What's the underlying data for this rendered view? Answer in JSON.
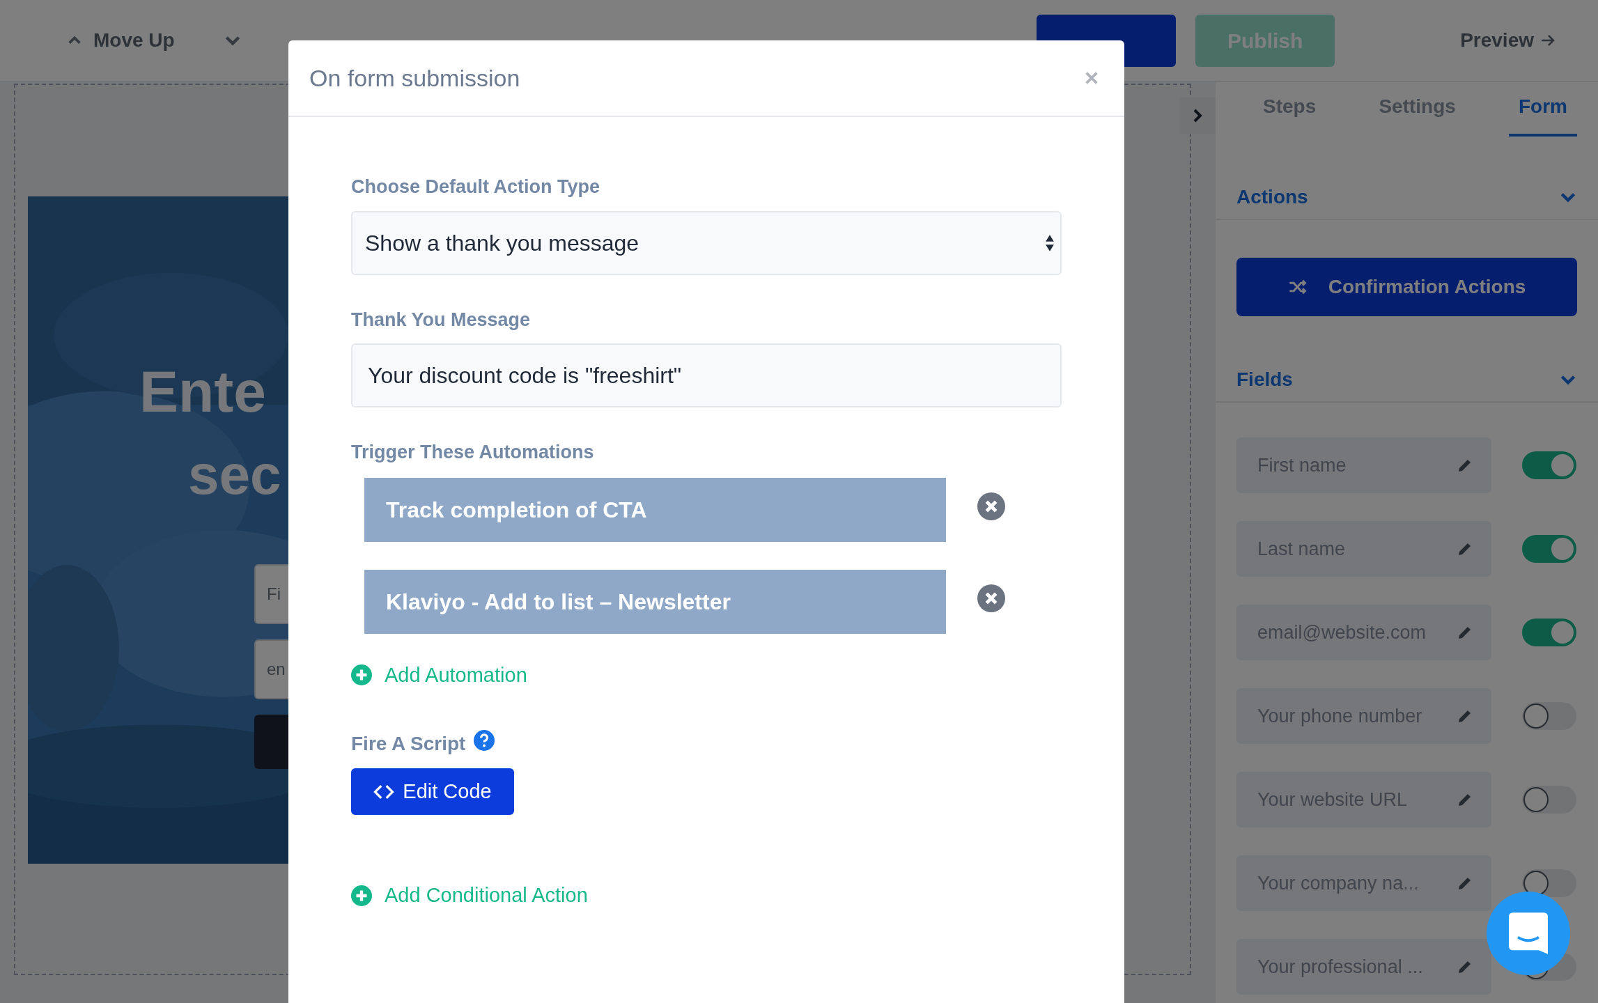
{
  "toolbar": {
    "actions": [
      "Move Up"
    ],
    "publish": "Publish",
    "preview": "Preview"
  },
  "canvas": {
    "headline": [
      "Ente",
      "sec"
    ],
    "fields": [
      {
        "placeholder": "Fi"
      },
      {
        "placeholder": "en"
      }
    ]
  },
  "sidebar": {
    "tabs": [
      {
        "label": "Steps",
        "selected": false
      },
      {
        "label": "Settings",
        "selected": false
      },
      {
        "label": "Form",
        "selected": true
      }
    ],
    "actions": {
      "title": "Actions",
      "expanded": true,
      "button": "Confirmation Actions"
    },
    "fields": {
      "title": "Fields",
      "expanded": true,
      "items": [
        {
          "label": "First name",
          "on": true
        },
        {
          "label": "Last name",
          "on": true
        },
        {
          "label": "email@website.com",
          "on": true
        },
        {
          "label": "Your phone number",
          "on": false
        },
        {
          "label": "Your website URL",
          "on": false
        },
        {
          "label": "Your company na...",
          "on": false
        },
        {
          "label": "Your professional ...",
          "on": false
        }
      ]
    }
  },
  "modal": {
    "title": "On form submission",
    "action_type": {
      "label": "Choose Default Action Type",
      "value": "Show a thank you message"
    },
    "thank_you": {
      "label": "Thank You Message",
      "value": "Your discount code is \"freeshirt\""
    },
    "automations": {
      "label": "Trigger These Automations",
      "items": [
        "Track completion of CTA",
        "Klaviyo - Add to list – Newsletter"
      ],
      "add": "Add Automation"
    },
    "script": {
      "label": "Fire A Script",
      "button": "Edit Code"
    },
    "add_conditional": "Add Conditional Action"
  }
}
